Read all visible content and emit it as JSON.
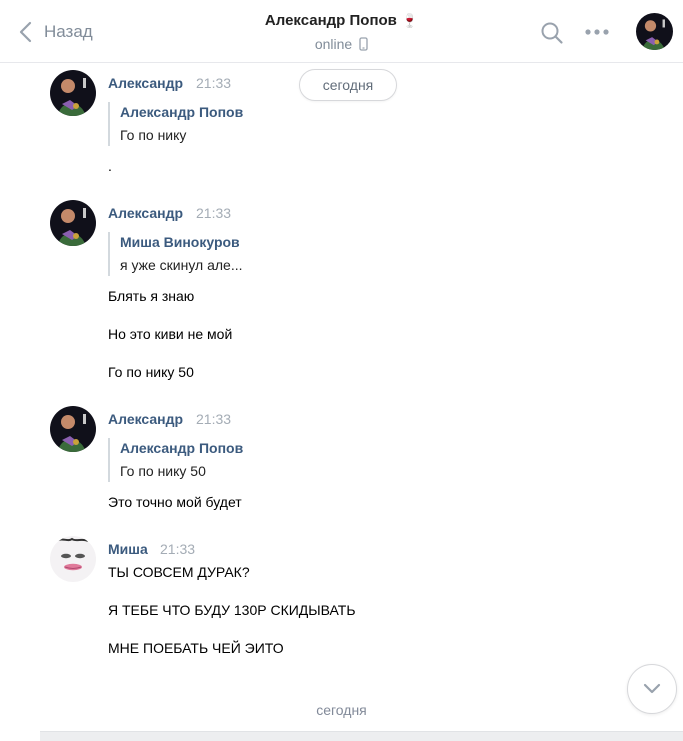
{
  "header": {
    "back_label": "Назад",
    "title": "Александр Попов",
    "title_emoji": "🍷",
    "status": "online"
  },
  "date_pill": "сегодня",
  "messages": [
    {
      "author": "Александр",
      "time": "21:33",
      "quote": {
        "author": "Александр Попов",
        "text": "Го по нику"
      },
      "lines": [
        "."
      ]
    },
    {
      "author": "Александр",
      "time": "21:33",
      "quote": {
        "author": "Миша Винокуров",
        "text": "я уже скинул але..."
      },
      "lines": [
        "Блять я знаю",
        "Но это киви не мой",
        "Го по нику 50"
      ]
    },
    {
      "author": "Александр",
      "time": "21:33",
      "quote": {
        "author": "Александр Попов",
        "text": "Го по нику 50"
      },
      "lines": [
        "Это точно мой будет"
      ]
    },
    {
      "author": "Миша",
      "time": "21:33",
      "lines": [
        "ТЫ СОВСЕМ ДУРАК?",
        "Я ТЕБЕ ЧТО БУДУ 130Р СКИДЫВАТЬ",
        "МНЕ ПОЕБАТЬ ЧЕЙ ЭИТО"
      ]
    }
  ],
  "bottom_date": "сегодня",
  "icons": {
    "back": "chevron-left-icon",
    "phone": "mobile-phone-icon",
    "search": "search-icon",
    "more": "more-dots-icon",
    "scroll_down": "chevron-down-icon"
  },
  "colors": {
    "link": "#3b5a7e",
    "muted": "#818c99",
    "time": "#a4acb5",
    "border": "#e7e8ec",
    "quote_bar": "#d3d9de"
  }
}
